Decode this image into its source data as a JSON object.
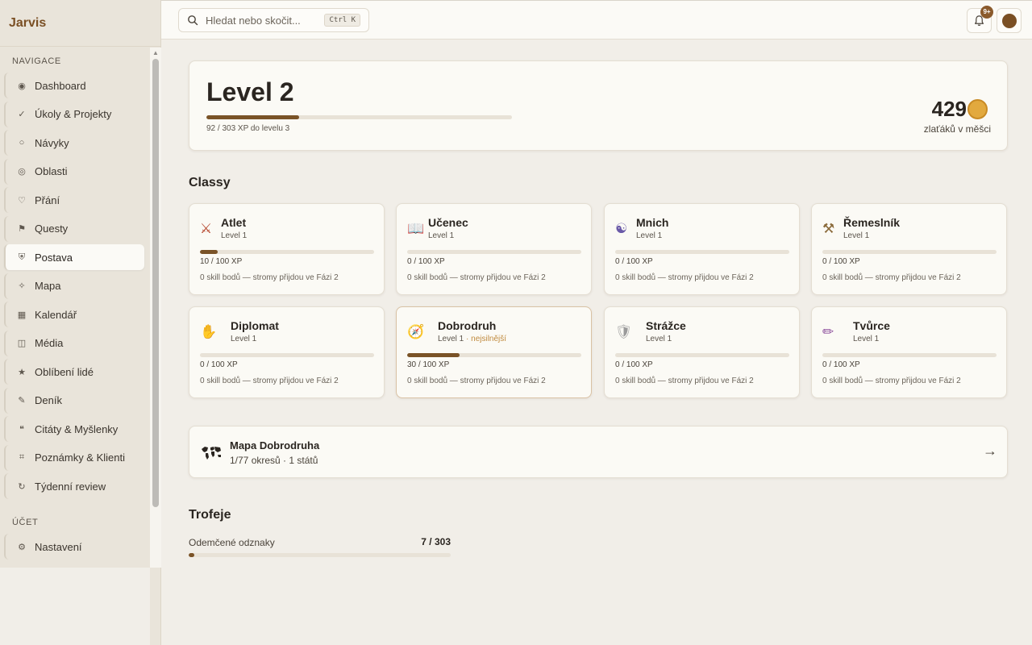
{
  "app": {
    "title": "Jarvis"
  },
  "sidebar": {
    "nav_heading": "NAVIGACE",
    "account_heading": "ÚČET",
    "items": [
      {
        "label": "Dashboard",
        "icon": "◉"
      },
      {
        "label": "Úkoly & Projekty",
        "icon": "✓"
      },
      {
        "label": "Návyky",
        "icon": "○"
      },
      {
        "label": "Oblasti",
        "icon": "◎"
      },
      {
        "label": "Přání",
        "icon": "♡"
      },
      {
        "label": "Questy",
        "icon": "⚑"
      },
      {
        "label": "Postava",
        "icon": "⛨"
      },
      {
        "label": "Mapa",
        "icon": "✧"
      },
      {
        "label": "Kalendář",
        "icon": "▦"
      },
      {
        "label": "Média",
        "icon": "◫"
      },
      {
        "label": "Oblíbení lidé",
        "icon": "★"
      },
      {
        "label": "Deník",
        "icon": "✎"
      },
      {
        "label": "Citáty & Myšlenky",
        "icon": "❝"
      },
      {
        "label": "Poznámky & Klienti",
        "icon": "⌗"
      },
      {
        "label": "Týdenní review",
        "icon": "↻"
      }
    ],
    "account_items": [
      {
        "label": "Nastavení",
        "icon": "⚙"
      }
    ],
    "active_index": 6
  },
  "topbar": {
    "search_placeholder": "Hledat nebo skočit...",
    "search_shortcut": "Ctrl K",
    "notification_count": "9+"
  },
  "level": {
    "title": "Level 2",
    "xp_caption": "92 / 303 XP do levelu 3",
    "xp_progress": 0.304,
    "gold": "429",
    "gold_caption": "zlaťáků v měšci"
  },
  "classes_section": "Classy",
  "classes": [
    {
      "name": "Atlet",
      "icon": "⚔",
      "icon_color": "#b5452c",
      "level": "Level 1",
      "tag": "",
      "xp": "10 / 100 XP",
      "progress": 0.1,
      "skill": "0 skill bodů — stromy přijdou ve Fázi 2"
    },
    {
      "name": "Učenec",
      "icon": "📖",
      "icon_color": "#4a7bbf",
      "level": "Level 1",
      "tag": "",
      "xp": "0 / 100 XP",
      "progress": 0,
      "skill": "0 skill bodů — stromy přijdou ve Fázi 2"
    },
    {
      "name": "Mnich",
      "icon": "☯",
      "icon_color": "#6a5aa8",
      "level": "Level 1",
      "tag": "",
      "xp": "0 / 100 XP",
      "progress": 0,
      "skill": "0 skill bodů — stromy přijdou ve Fázi 2"
    },
    {
      "name": "Řemeslník",
      "icon": "⚒",
      "icon_color": "#8a6a3a",
      "level": "Level 1",
      "tag": "",
      "xp": "0 / 100 XP",
      "progress": 0,
      "skill": "0 skill bodů — stromy přijdou ve Fázi 2"
    },
    {
      "name": "Diplomat",
      "icon": "✋",
      "icon_color": "#e0a92c",
      "level": "Level 1",
      "tag": "",
      "xp": "0 / 100 XP",
      "progress": 0,
      "skill": "0 skill bodů — stromy přijdou ve Fázi 2"
    },
    {
      "name": "Dobrodruh",
      "icon": "🧭",
      "icon_color": "#c08a3e",
      "level": "Level 1",
      "tag": " · nejsilnější",
      "xp": "30 / 100 XP",
      "progress": 0.3,
      "skill": "0 skill bodů — stromy přijdou ve Fázi 2",
      "highlight": true
    },
    {
      "name": "Strážce",
      "icon": "🛡",
      "icon_color": "#9a9a9a",
      "level": "Level 1",
      "tag": "",
      "xp": "0 / 100 XP",
      "progress": 0,
      "skill": "0 skill bodů — stromy přijdou ve Fázi 2"
    },
    {
      "name": "Tvůrce",
      "icon": "✏",
      "icon_color": "#8a4a9a",
      "level": "Level 1",
      "tag": "",
      "xp": "0 / 100 XP",
      "progress": 0,
      "skill": "0 skill bodů — stromy přijdou ve Fázi 2"
    }
  ],
  "map": {
    "title": "Mapa Dobrodruha",
    "subtitle": "1/77 okresů · 1 států",
    "arrow": "→"
  },
  "trophies": {
    "title": "Trofeje",
    "label": "Odemčené odznaky",
    "count": "7 / 303",
    "progress": 0.023
  }
}
